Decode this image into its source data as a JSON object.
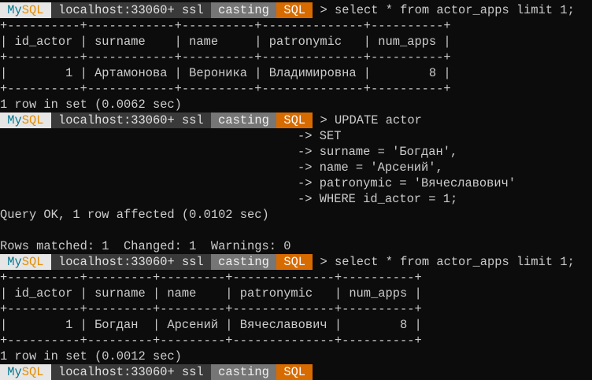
{
  "prompt": {
    "my": "My",
    "sql": "SQL",
    "host": "localhost:33060+ ssl",
    "schema": "casting",
    "mode": "SQL",
    "arrow": ">"
  },
  "commands": {
    "select1": "select * from actor_apps limit 1;",
    "update": [
      "UPDATE actor",
      "SET",
      "surname = 'Богдан',",
      "name = 'Арсений',",
      "patronymic = 'Вячеславович'",
      "WHERE id_actor = 1;"
    ],
    "continuation": "->",
    "select2": "select * from actor_apps limit 1;"
  },
  "table1": {
    "border": "+----------+------------+----------+--------------+----------+",
    "header": "| id_actor | surname    | name     | patronymic   | num_apps |",
    "row": "|        1 | Артамонова | Вероника | Владимировна |        8 |",
    "status": "1 row in set (0.0062 sec)"
  },
  "update_result": {
    "status": "Query OK, 1 row affected (0.0102 sec)",
    "info": "Rows matched: 1  Changed: 1  Warnings: 0"
  },
  "table2": {
    "border": "+----------+---------+---------+--------------+----------+",
    "header": "| id_actor | surname | name    | patronymic   | num_apps |",
    "row": "|        1 | Богдан  | Арсений | Вячеславович |        8 |",
    "status": "1 row in set (0.0012 sec)"
  }
}
